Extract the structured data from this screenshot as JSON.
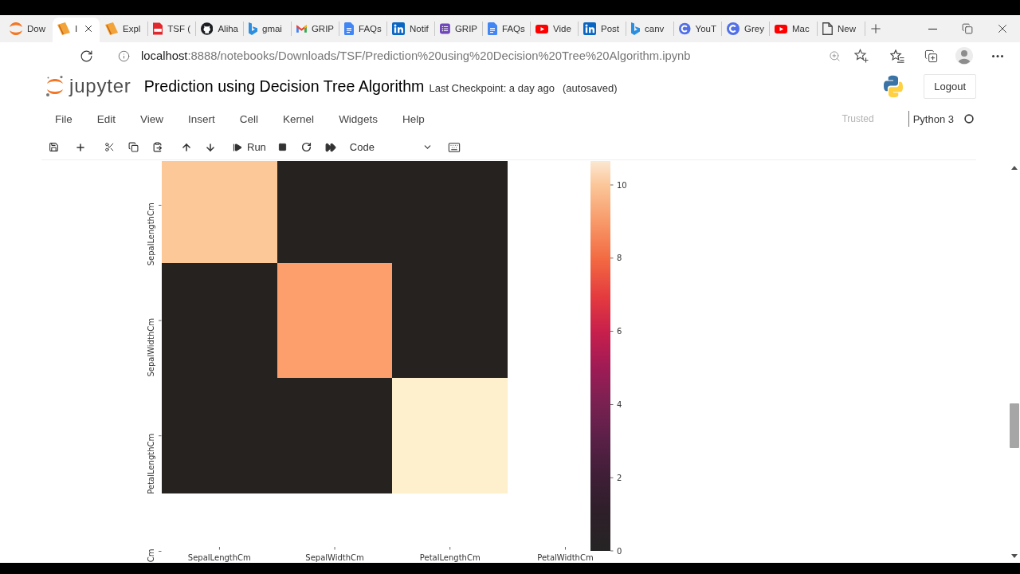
{
  "tabs": [
    {
      "title": "Dow",
      "kind": "arcs",
      "selected": false
    },
    {
      "title": "I",
      "kind": "book",
      "selected": true
    },
    {
      "title": "Expl",
      "kind": "book",
      "selected": false
    },
    {
      "title": "TSF (",
      "kind": "file",
      "selected": false
    },
    {
      "title": "Aliha",
      "kind": "cat",
      "selected": false
    },
    {
      "title": "gmai",
      "kind": "ribbon",
      "selected": false
    },
    {
      "title": "GRIP",
      "kind": "mlogo",
      "selected": false
    },
    {
      "title": "FAQs",
      "kind": "doc",
      "selected": false
    },
    {
      "title": "Notif",
      "kind": "insquare",
      "selected": false
    },
    {
      "title": "GRIP",
      "kind": "list",
      "selected": false
    },
    {
      "title": "FAQs",
      "kind": "doc",
      "selected": false
    },
    {
      "title": "Vide",
      "kind": "play",
      "selected": false
    },
    {
      "title": "Post",
      "kind": "insquare",
      "selected": false
    },
    {
      "title": "canv",
      "kind": "ribbon",
      "selected": false
    },
    {
      "title": "YouT",
      "kind": "ring",
      "selected": false
    },
    {
      "title": "Grey",
      "kind": "ring",
      "selected": false
    },
    {
      "title": "Mac",
      "kind": "play",
      "selected": false
    },
    {
      "title": "New",
      "kind": "page",
      "selected": false
    }
  ],
  "address_bar": {
    "url_host": "localhost",
    "url_path": ":8888/notebooks/Downloads/TSF/Prediction%20using%20Decision%20Tree%20Algorithm.ipynb"
  },
  "header": {
    "logo_text": "jupyter",
    "title": "Prediction using Decision Tree Algorithm",
    "checkpoint": "Last Checkpoint: a day ago",
    "autosave_status": "(autosaved)",
    "logout": "Logout"
  },
  "menubar": {
    "items": [
      "File",
      "Edit",
      "View",
      "Insert",
      "Cell",
      "Kernel",
      "Widgets",
      "Help"
    ],
    "trusted": "Trusted",
    "kernel": {
      "name": "Python 3",
      "busy": false
    }
  },
  "toolbar": {
    "run": "Run",
    "cell_type": "Code"
  },
  "heatmap": {
    "row_labels": [
      "SepalLengthCm",
      "SepalWidthCm",
      "PetalLengthCm",
      "Cm"
    ],
    "column_labels": [
      "SepalLengthCm",
      "SepalWidthCm",
      "PetalLengthCm",
      "PetalWidthCm"
    ],
    "cells": [
      [
        {
          "color": "#fcc897"
        },
        {
          "color": "#252220"
        },
        {
          "color": "#252220"
        }
      ],
      [
        {
          "color": "#252220"
        },
        {
          "color": "#fd9f6c"
        },
        {
          "color": "#252220"
        }
      ],
      [
        {
          "color": "#252220"
        },
        {
          "color": "#252220"
        },
        {
          "color": "#fef0cc"
        }
      ]
    ],
    "colorbar_ticks": [
      "10",
      "8",
      "6",
      "4",
      "2",
      "0"
    ]
  }
}
